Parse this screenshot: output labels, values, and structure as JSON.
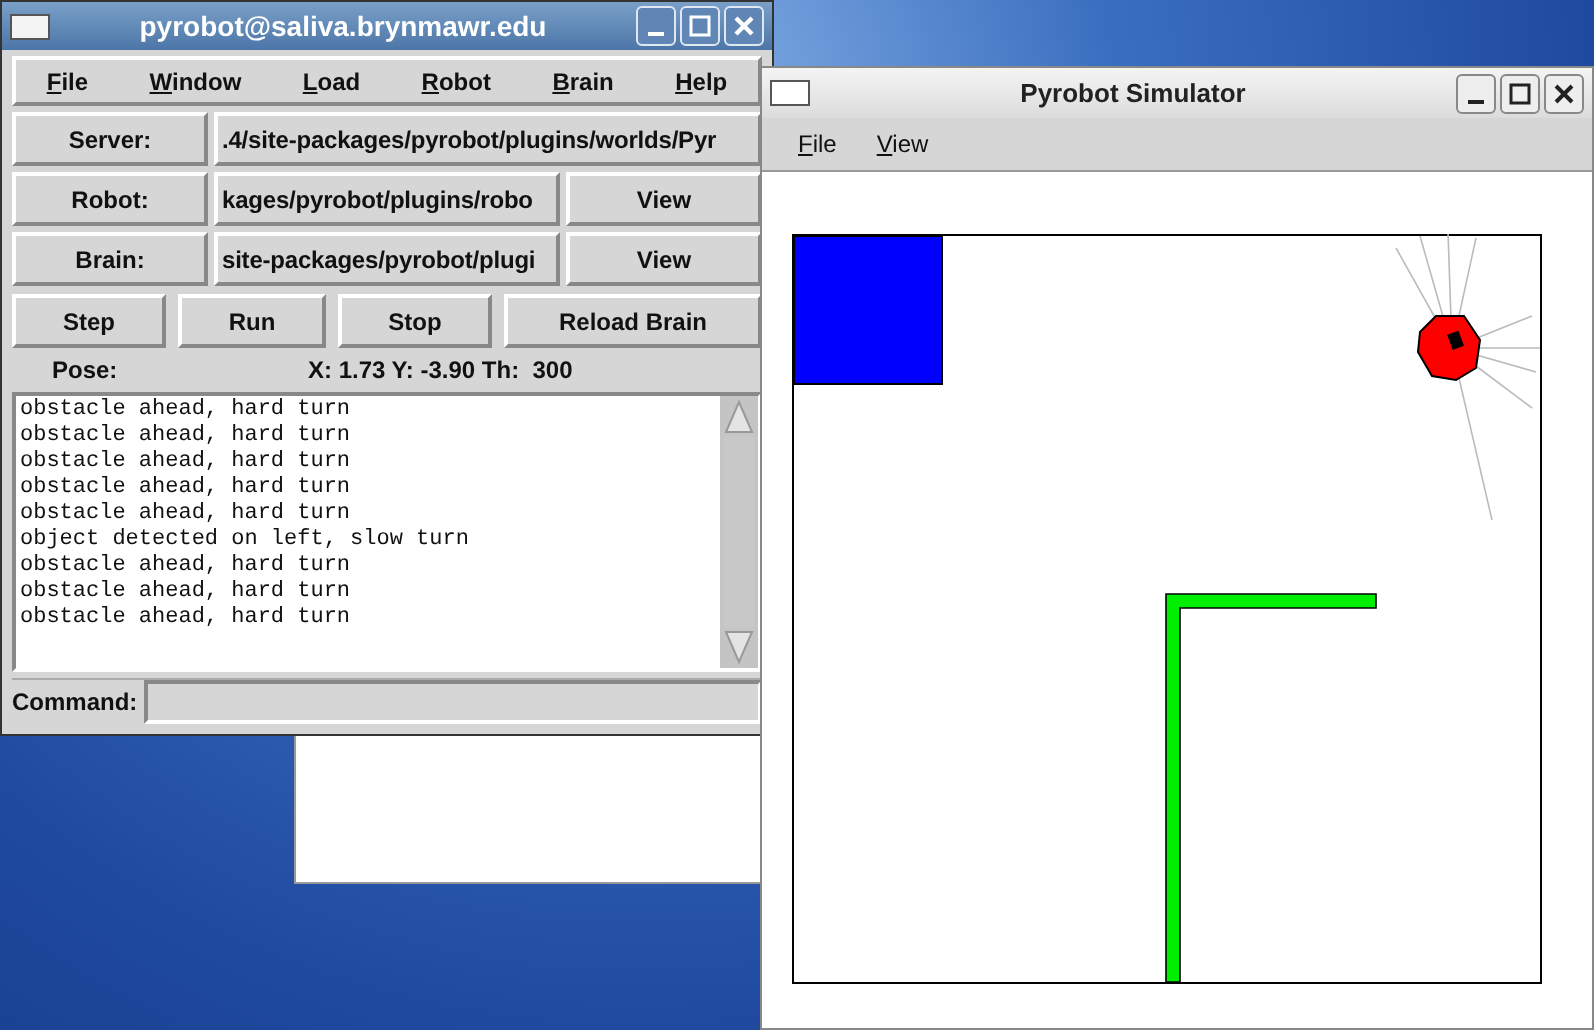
{
  "console_window": {
    "title": "pyrobot@saliva.brynmawr.edu",
    "menu": [
      "File",
      "Window",
      "Load",
      "Robot",
      "Brain",
      "Help"
    ],
    "rows": [
      {
        "label": "Server:",
        "path": ".4/site-packages/pyrobot/plugins/worlds/Pyr"
      },
      {
        "label": "Robot:",
        "path": "kages/pyrobot/plugins/robo",
        "view": "View"
      },
      {
        "label": "Brain:",
        "path": "site-packages/pyrobot/plugi",
        "view": "View"
      }
    ],
    "buttons": [
      "Step",
      "Run",
      "Stop",
      "Reload Brain"
    ],
    "pose_label": "Pose:",
    "pose_value": "X: 1.73 Y: -3.90 Th:  300",
    "log": [
      "obstacle ahead, hard turn",
      "obstacle ahead, hard turn",
      "obstacle ahead, hard turn",
      "obstacle ahead, hard turn",
      "obstacle ahead, hard turn",
      "object detected on left, slow turn",
      "obstacle ahead, hard turn",
      "obstacle ahead, hard turn",
      "obstacle ahead, hard turn"
    ],
    "command_label": "Command:"
  },
  "simulator_window": {
    "title": "Pyrobot Simulator",
    "menu": [
      "File",
      "View"
    ]
  }
}
